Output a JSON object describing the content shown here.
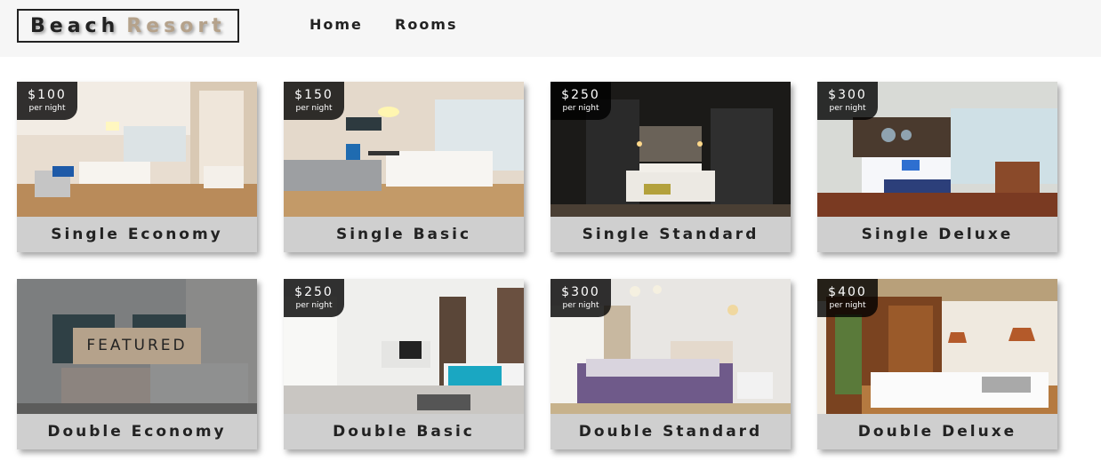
{
  "brand": {
    "part1": "Beach",
    "part2": "Resort"
  },
  "nav": [
    {
      "label": "Home"
    },
    {
      "label": "Rooms"
    }
  ],
  "per_night": "per night",
  "rooms": [
    {
      "name": "Single Economy",
      "price": "$100",
      "featured": false,
      "scene": "warm"
    },
    {
      "name": "Single Basic",
      "price": "$150",
      "featured": false,
      "scene": "bright"
    },
    {
      "name": "Single Standard",
      "price": "$250",
      "featured": false,
      "scene": "dark"
    },
    {
      "name": "Single Deluxe",
      "price": "$300",
      "featured": false,
      "scene": "deluxe"
    },
    {
      "name": "Double Economy",
      "price": "",
      "featured": true,
      "badge": "FEATURED",
      "scene": "grey"
    },
    {
      "name": "Double Basic",
      "price": "$250",
      "featured": false,
      "scene": "loft"
    },
    {
      "name": "Double Standard",
      "price": "$300",
      "featured": false,
      "scene": "purple"
    },
    {
      "name": "Double Deluxe",
      "price": "$400",
      "featured": false,
      "scene": "wood"
    }
  ]
}
